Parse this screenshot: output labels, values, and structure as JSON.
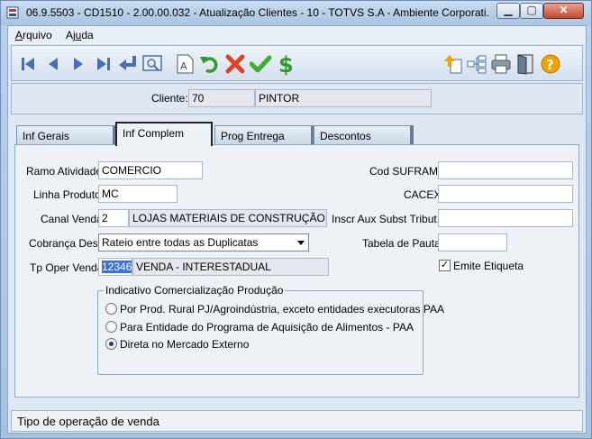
{
  "window": {
    "title": "06.9.5503 - CD1510 - 2.00.00.032 - Atualização Clientes - 10 - TOTVS S.A - Ambiente Corporati..."
  },
  "menu": [
    {
      "underline": "A",
      "rest": "rquivo"
    },
    {
      "pre": "Aj",
      "underline": "u",
      "post": "da"
    }
  ],
  "cliente": {
    "label": "Cliente:",
    "code": "70",
    "blank": "",
    "name": "PINTOR"
  },
  "tabs": [
    "Inf Gerais",
    "Inf Complem",
    "Prog Entrega",
    "Descontos"
  ],
  "form": {
    "ramo_label": "Ramo Atividade:",
    "ramo_value": "COMERCIO",
    "linha_label": "Linha Produto:",
    "linha_value": "MC",
    "canal_label": "Canal Venda:",
    "canal_code": "2",
    "canal_desc": "LOJAS MATERIAIS DE CONSTRUÇÃO",
    "cobranca_label": "Cobrança Desp:",
    "cobranca_value": "Rateio entre todas as Duplicatas",
    "tpoper_label": "Tp Oper Venda:",
    "tpoper_code": "12346",
    "tpoper_desc": "VENDA - INTERESTADUAL",
    "suframa_label": "Cod SUFRAMA:",
    "suframa_value": "",
    "cacex_label": "CACEX:",
    "cacex_value": "",
    "inscr_label": "Inscr Aux Subst Tribut.:",
    "inscr_value": "",
    "pauta_label": "Tabela de Pauta:",
    "pauta_value": "",
    "emite_label": "Emite Etiqueta",
    "emite_checked": "✓"
  },
  "group": {
    "title": "Indicativo Comercialização Produção",
    "options": [
      "Por Prod. Rural PJ/Agroindústria, exceto entidades executoras PAA",
      "Para Entidade do Programa de Aquisição de Alimentos - PAA",
      "Direta no Mercado Externo"
    ],
    "selected_index": 2
  },
  "status": {
    "text": "Tipo de operação de venda"
  },
  "colors": {
    "accent_selection": "#3a74d6",
    "toolbar_nav": "#4a6fb0",
    "undo_green": "#2f9a2f",
    "cancel_red": "#d8432a",
    "ok_green": "#3fae2c",
    "money_green": "#2e9a2e",
    "help_orange": "#f2a100"
  },
  "icons": [
    "first-icon",
    "prev-icon",
    "next-icon",
    "last-icon",
    "return-icon",
    "zoom-icon",
    "text-icon",
    "undo-icon",
    "cancel-icon",
    "confirm-icon",
    "money-icon",
    "upload-icon",
    "tree-icon",
    "print-icon",
    "exit-icon",
    "help-icon"
  ]
}
